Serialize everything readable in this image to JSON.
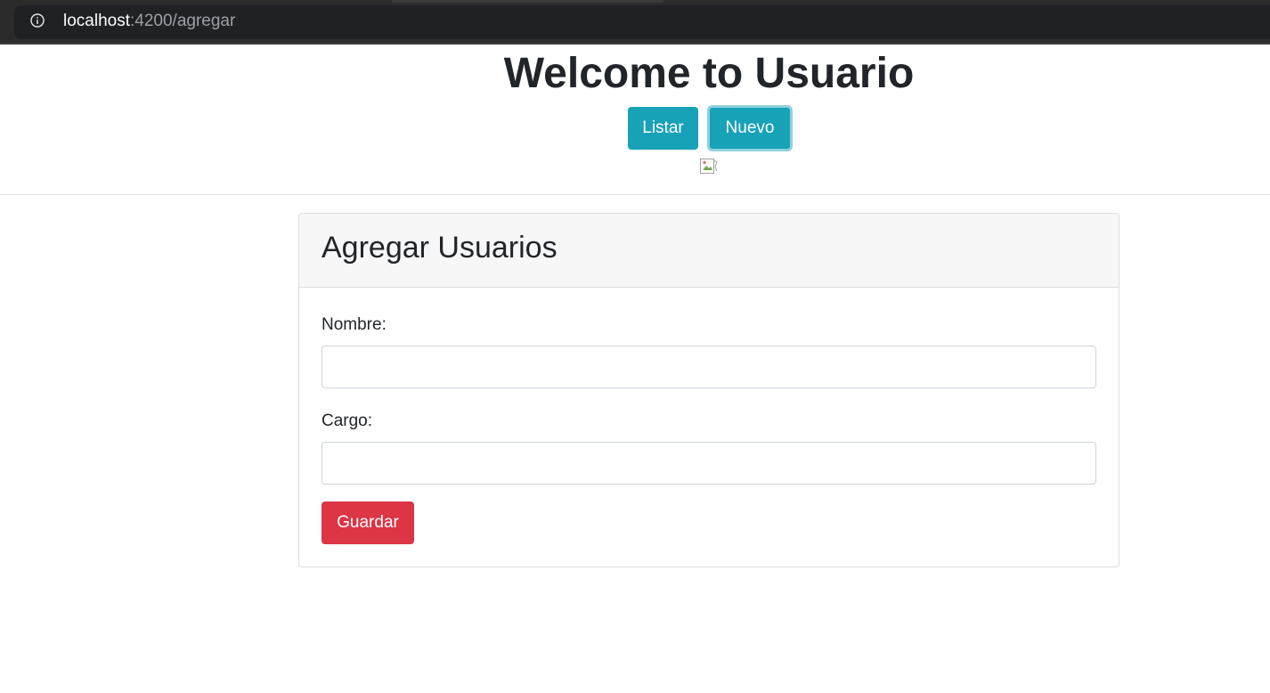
{
  "browser": {
    "url_host": "localhost",
    "url_path": ":4200/agregar",
    "info_icon": "info-icon"
  },
  "header": {
    "title": "Welcome to Usuario",
    "listar_label": "Listar",
    "nuevo_label": "Nuevo",
    "broken_image_icon": "broken-image-icon"
  },
  "card": {
    "title": "Agregar Usuarios",
    "nombre_label": "Nombre:",
    "nombre_value": "",
    "cargo_label": "Cargo:",
    "cargo_value": "",
    "guardar_label": "Guardar"
  },
  "colors": {
    "info": "#17a2b8",
    "danger": "#dc3545",
    "chrome": "#202124"
  }
}
